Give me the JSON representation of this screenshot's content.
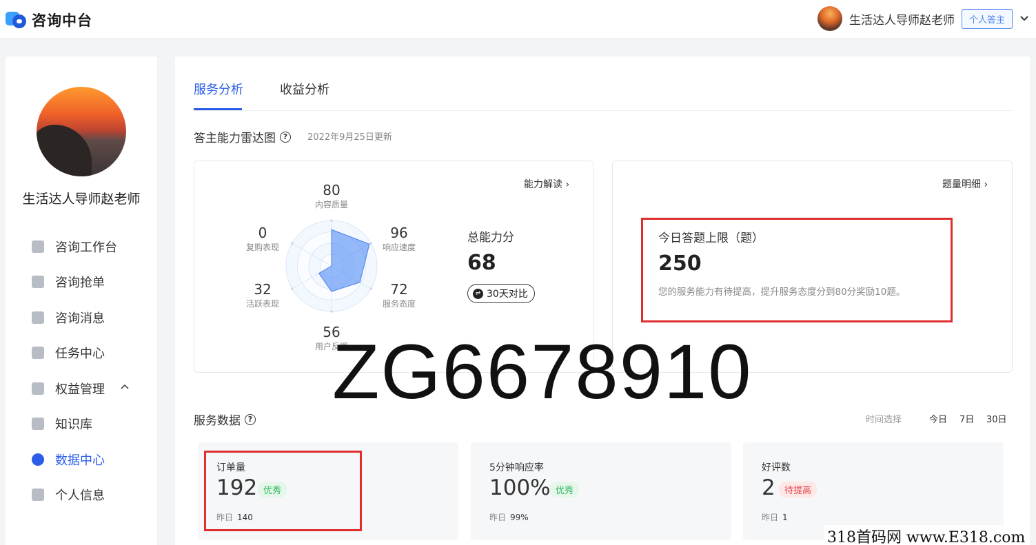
{
  "header": {
    "app_title": "咨询中台",
    "user_name": "生活达人导师赵老师",
    "role": "个人答主",
    "dropdown_icon": "chevron-down-icon"
  },
  "sidebar": {
    "user_name": "生活达人导师赵老师",
    "items": [
      {
        "label": "咨询工作台",
        "icon": "grid-icon"
      },
      {
        "label": "咨询抢单",
        "icon": "edit-icon"
      },
      {
        "label": "咨询消息",
        "icon": "chat-icon"
      },
      {
        "label": "任务中心",
        "icon": "clipboard-icon"
      },
      {
        "label": "权益管理",
        "icon": "crown-icon"
      },
      {
        "label": "知识库",
        "icon": "book-icon"
      },
      {
        "label": "数据中心",
        "icon": "pie-chart-icon"
      },
      {
        "label": "个人信息",
        "icon": "document-icon"
      }
    ],
    "active_item": "数据中心",
    "accent_color": "#2b5de8"
  },
  "tabs": [
    "服务分析",
    "收益分析"
  ],
  "radar": {
    "title": "答主能力雷达图",
    "updated": "2022年9月25日更新",
    "link": "能力解读",
    "total_label": "总能力分",
    "total_value": "68",
    "compare_label": "30天对比",
    "dimensions": [
      {
        "label": "内容质量",
        "value": 80
      },
      {
        "label": "响应速度",
        "value": 96
      },
      {
        "label": "服务态度",
        "value": 72
      },
      {
        "label": "用户反馈",
        "value": 56
      },
      {
        "label": "活跃表现",
        "value": 32
      },
      {
        "label": "复购表现",
        "value": 0
      }
    ]
  },
  "quota": {
    "link": "题量明细",
    "title": "今日答题上限（题）",
    "value": "250",
    "note": "您的服务能力有待提高，提升服务态度分到80分奖励10题。"
  },
  "service": {
    "title": "服务数据",
    "time_label": "时间选择",
    "time_options": [
      "今日",
      "7日",
      "30日"
    ],
    "stats": [
      {
        "title": "订单量",
        "value": "192",
        "badge": "优秀",
        "yesterday_label": "昨日",
        "yesterday": "140"
      },
      {
        "title": "5分钟响应率",
        "value": "100%",
        "badge": "优秀",
        "yesterday_label": "昨日",
        "yesterday": "99%"
      },
      {
        "title": "好评数",
        "value": "2",
        "badge": "待提高",
        "yesterday_label": "昨日",
        "yesterday": "1"
      }
    ]
  },
  "overlays": {
    "watermark": "ZG6678910",
    "site_mark": "318首码网 www.E318.com"
  }
}
